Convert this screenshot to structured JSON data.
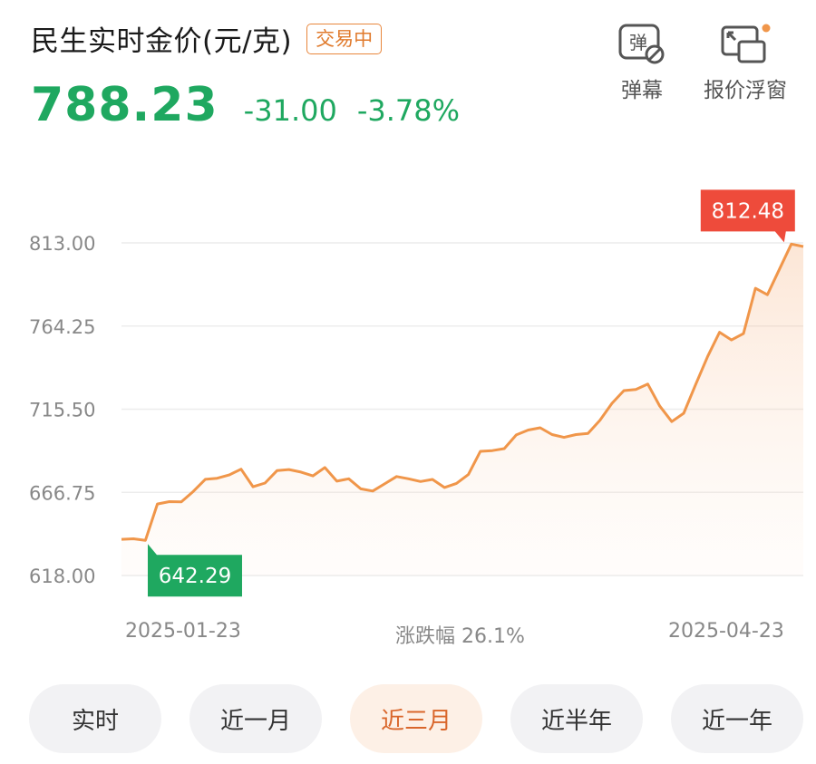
{
  "header": {
    "title": "民生实时金价(元/克)",
    "status": "交易中",
    "price": "788.23",
    "change": "-31.00",
    "change_pct": "-3.78%"
  },
  "toolbar": {
    "danmu_label": "弹幕",
    "danmu_icon_char": "弹",
    "float_label": "报价浮窗"
  },
  "colors": {
    "down_green": "#1fa860",
    "up_red": "#ee4b3b",
    "line_orange": "#f0964a",
    "active_tab": "#d9662b"
  },
  "chart_data": {
    "type": "area",
    "ylim": [
      618.0,
      813.0
    ],
    "yticks": [
      "813.00",
      "764.25",
      "715.50",
      "666.75",
      "618.00"
    ],
    "values": [
      639.2,
      639.5,
      638.6,
      659.9,
      661.3,
      661.2,
      667.3,
      674.4,
      675.0,
      676.9,
      680.3,
      670.0,
      672.2,
      679.5,
      680.1,
      678.6,
      676.4,
      681.3,
      673.3,
      674.7,
      668.8,
      667.5,
      671.7,
      676.0,
      674.7,
      673.1,
      674.3,
      669.6,
      672.0,
      677.2,
      690.8,
      691.2,
      692.4,
      700.4,
      703.3,
      704.6,
      700.6,
      699.0,
      700.6,
      701.3,
      709.0,
      718.9,
      726.4,
      727.1,
      730.2,
      717.3,
      708.2,
      713.1,
      730.0,
      746.4,
      760.6,
      756.1,
      759.8,
      786.4,
      782.6,
      797.5,
      812.3,
      810.9
    ],
    "high_label": "812.48",
    "low_label": "642.29",
    "x_start": "2025-01-23",
    "x_end": "2025-04-23",
    "range_text": "涨跌幅 26.1%"
  },
  "tabs": [
    {
      "label": "实时",
      "active": false
    },
    {
      "label": "近一月",
      "active": false
    },
    {
      "label": "近三月",
      "active": true
    },
    {
      "label": "近半年",
      "active": false
    },
    {
      "label": "近一年",
      "active": false
    }
  ]
}
